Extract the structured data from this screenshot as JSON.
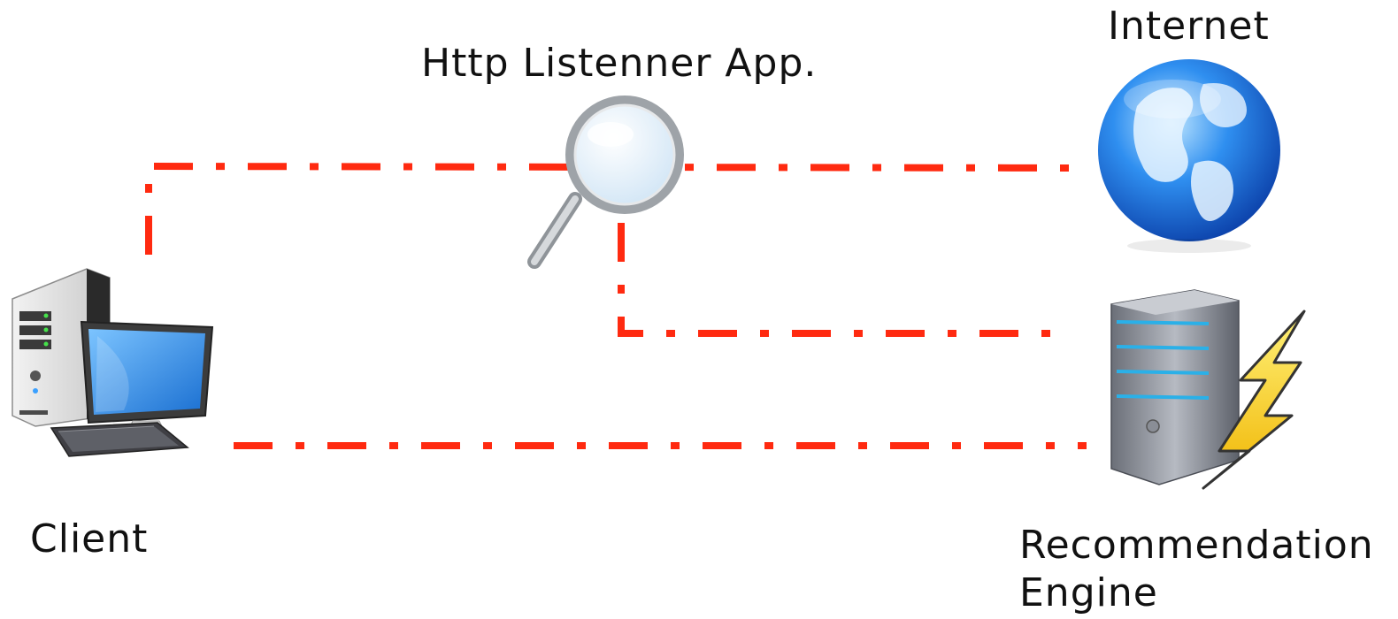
{
  "nodes": {
    "internet": {
      "label": "Internet",
      "icon": "globe-icon"
    },
    "listener": {
      "label": "Http Listenner App.",
      "icon": "magnifying-glass-icon"
    },
    "client": {
      "label": "Client",
      "icon": "desktop-computer-icon"
    },
    "engine": {
      "label_line1": "Recommendation",
      "label_line2": "Engine",
      "icon": "server-lightning-icon"
    }
  },
  "connections": [
    {
      "from": "client",
      "to": "internet",
      "via": "listener"
    },
    {
      "from": "listener",
      "to": "engine"
    },
    {
      "from": "client",
      "to": "engine"
    }
  ],
  "colors": {
    "connector": "#ff2a10",
    "globe": "#1e78e6",
    "screen": "#2f8fea",
    "bolt": "#ffd21a"
  }
}
